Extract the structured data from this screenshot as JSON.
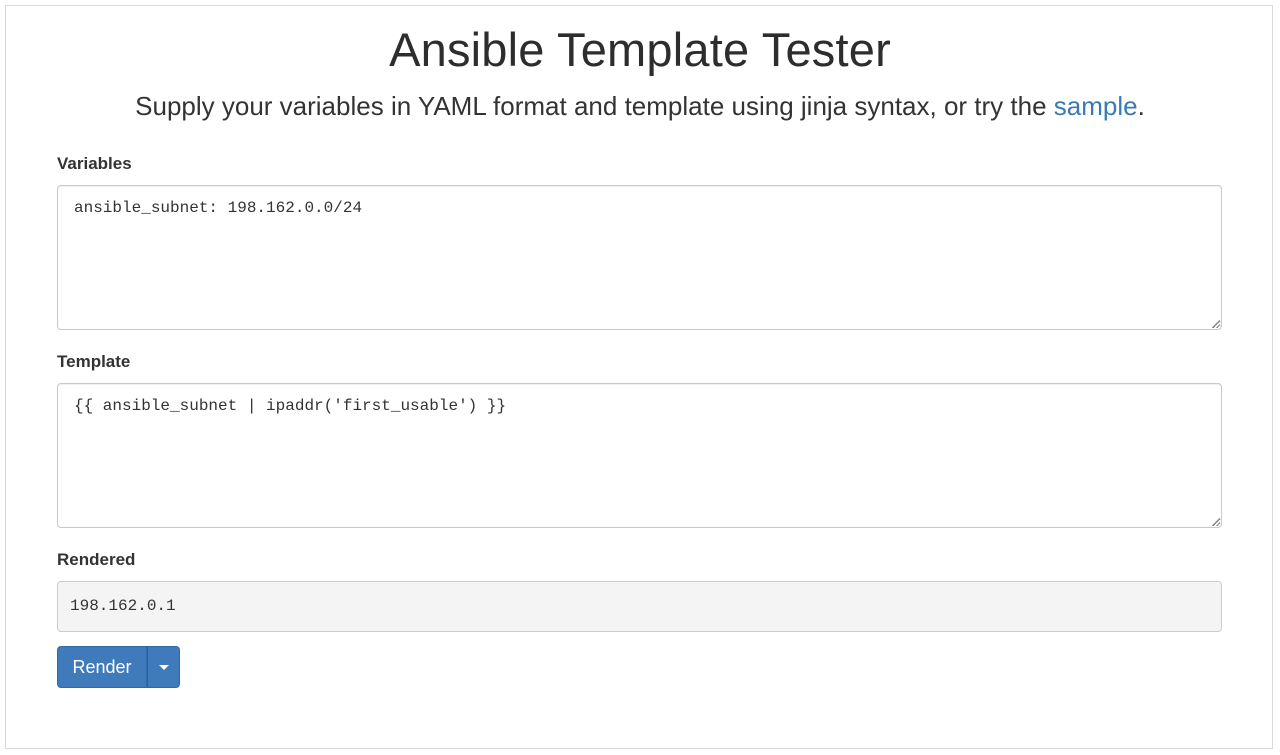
{
  "header": {
    "title": "Ansible Template Tester",
    "subtitle_text": "Supply your variables in YAML format and template using jinja syntax, or try the ",
    "subtitle_link": "sample",
    "subtitle_end": "."
  },
  "variables": {
    "label": "Variables",
    "value": "ansible_subnet: 198.162.0.0/24"
  },
  "template": {
    "label": "Template",
    "value": "{{ ansible_subnet | ipaddr('first_usable') }}"
  },
  "rendered": {
    "label": "Rendered",
    "value": "198.162.0.1"
  },
  "actions": {
    "render_label": "Render",
    "dropdown_icon": "caret-down-icon"
  },
  "colors": {
    "primary_button": "#3f7bbb",
    "link": "#3a7ab3",
    "rendered_background": "#f4f4f4"
  }
}
